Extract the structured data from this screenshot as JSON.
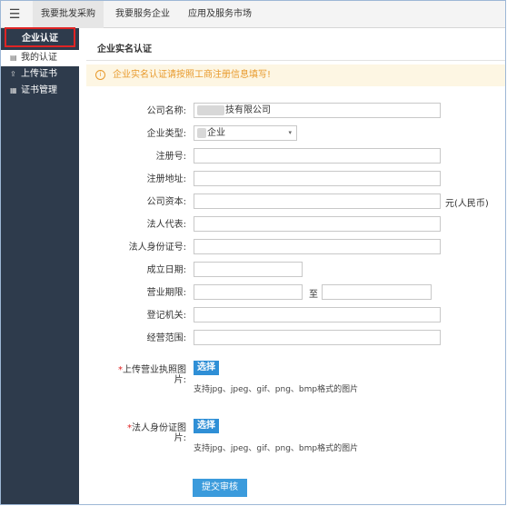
{
  "topbar": {
    "menu_icon": "menu-icon",
    "tabs": [
      {
        "label": "我要批发采购"
      },
      {
        "label": "我要服务企业"
      },
      {
        "label": "应用及服务市场"
      }
    ]
  },
  "sidebar": {
    "title": "企业认证",
    "items": [
      {
        "label": "我的认证",
        "icon": "certificate-icon",
        "glyph": "▤"
      },
      {
        "label": "上传证书",
        "icon": "upload-icon",
        "glyph": "⇪"
      },
      {
        "label": "证书管理",
        "icon": "manage-icon",
        "glyph": "▦"
      }
    ]
  },
  "main": {
    "section_title": "企业实名认证",
    "notice_icon": "info-icon",
    "notice_glyph": "i",
    "notice": "企业实名认证请按照工商注册信息填写!",
    "form": {
      "company_name_label": "公司名称:",
      "company_name_value": "技有限公司",
      "company_type_label": "企业类型:",
      "company_type_value": "企业",
      "reg_no_label": "注册号:",
      "reg_addr_label": "注册地址:",
      "capital_label": "公司资本:",
      "capital_unit": "元(人民币)",
      "legal_rep_label": "法人代表:",
      "legal_id_label": "法人身份证号:",
      "founded_label": "成立日期:",
      "term_label": "营业期限:",
      "term_to": "至",
      "authority_label": "登记机关:",
      "scope_label": "经营范围:",
      "license_label_1": "上传营业执照图",
      "license_label_2": "片:",
      "legal_id_img_label": "法人身份证图",
      "legal_id_img_label_2": "片:",
      "choose_button": "选择",
      "format_hint": "支持jpg、jpeg、gif、png、bmp格式的图片",
      "submit": "提交审核"
    }
  },
  "colors": {
    "sidebar_bg": "#2e3b4c",
    "notice_text": "#e89a2c",
    "notice_bg": "#fdf6e3",
    "primary": "#2f8fd6",
    "required": "#e02424"
  }
}
